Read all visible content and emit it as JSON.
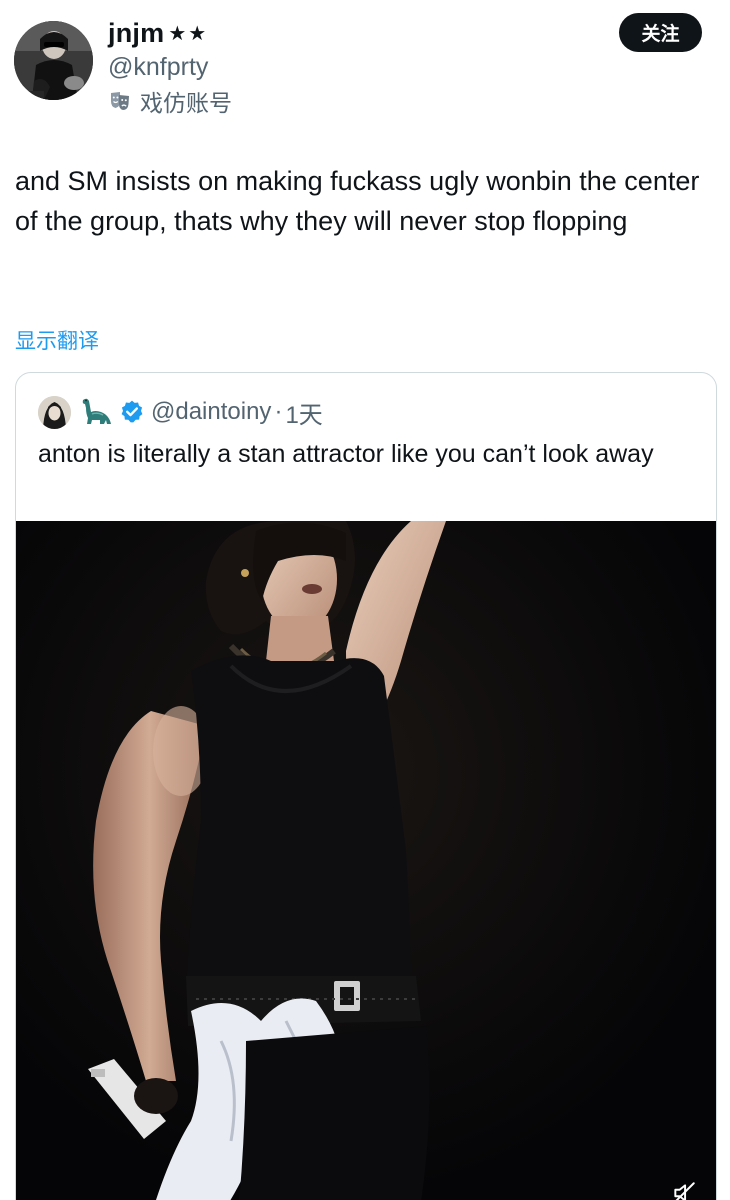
{
  "tweet": {
    "author": {
      "display_name": "jnjm",
      "stars": "★★",
      "handle": "@knfprty",
      "parody_label": "戏仿账号",
      "avatar_icon": "user-avatar"
    },
    "follow_button": "关注",
    "text": "and SM insists on making fuckass ugly wonbin the center of the group, thats why they will never stop flopping",
    "translate_link": "显示翻译"
  },
  "quote": {
    "handle": "@daintoiny",
    "separator": "·",
    "time": "1天",
    "text": "anton is literally a stan attractor like you can’t look away",
    "icons": [
      "avatar",
      "dinosaur-emoji",
      "verified-badge"
    ],
    "media": {
      "type": "video",
      "mute_icon": "muted-speaker-icon"
    }
  },
  "colors": {
    "text_primary": "#0f1419",
    "text_secondary": "#536471",
    "link": "#1d9bf0",
    "verified": "#1d9bf0",
    "button_bg": "#0f1419",
    "border": "#cfd9de",
    "media_bg": "#050507"
  }
}
